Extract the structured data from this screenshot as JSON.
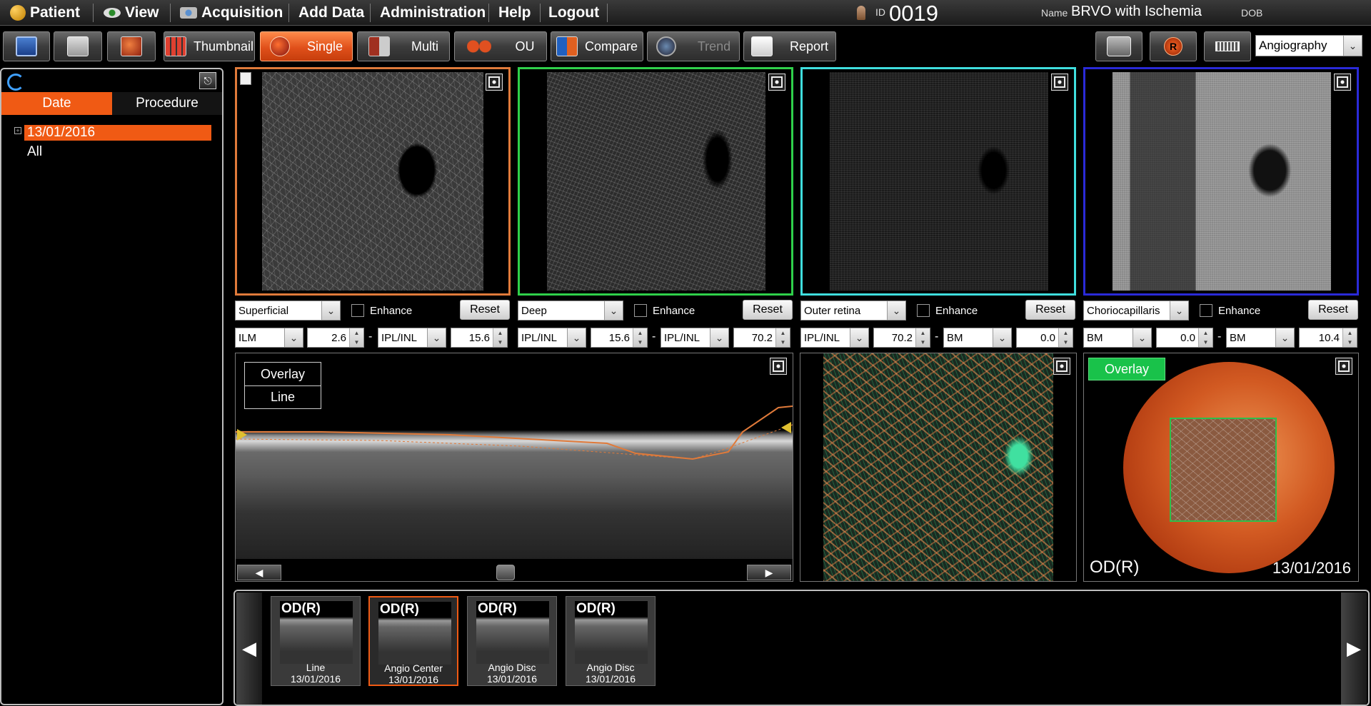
{
  "menu": {
    "items": [
      {
        "label": "Patient",
        "icon": "patient-icon"
      },
      {
        "label": "View",
        "icon": "eye-icon"
      },
      {
        "label": "Acquisition",
        "icon": "camera-icon"
      },
      {
        "label": "Add Data"
      },
      {
        "label": "Administration"
      },
      {
        "label": "Help"
      },
      {
        "label": "Logout"
      }
    ],
    "patient_id_label": "ID",
    "patient_id": "0019",
    "name_label": "Name",
    "name": "BRVO with Ischemia",
    "dob_label": "DOB"
  },
  "toolbar": {
    "buttons": [
      {
        "label": "Thumbnail"
      },
      {
        "label": "Single",
        "active": true
      },
      {
        "label": "Multi"
      },
      {
        "label": "OU"
      },
      {
        "label": "Compare"
      },
      {
        "label": "Trend",
        "disabled": true
      },
      {
        "label": "Report"
      }
    ],
    "right_icon_badge": "R",
    "mode_select": "Angiography"
  },
  "left": {
    "tabs": [
      "Date",
      "Procedure"
    ],
    "active_tab": "Date",
    "tree": [
      "13/01/2016",
      "All"
    ],
    "tree_expander": "+"
  },
  "layers": [
    {
      "preset": "Superficial",
      "enhance_label": "Enhance",
      "reset": "Reset",
      "top_layer": "ILM",
      "top_offset": "2.6",
      "bottom_layer": "IPL/INL",
      "bottom_offset": "15.6",
      "border": "#e07a3a"
    },
    {
      "preset": "Deep",
      "enhance_label": "Enhance",
      "reset": "Reset",
      "top_layer": "IPL/INL",
      "top_offset": "15.6",
      "bottom_layer": "IPL/INL",
      "bottom_offset": "70.2",
      "border": "#2fd04a"
    },
    {
      "preset": "Outer retina",
      "enhance_label": "Enhance",
      "reset": "Reset",
      "top_layer": "IPL/INL",
      "top_offset": "70.2",
      "bottom_layer": "BM",
      "bottom_offset": "0.0",
      "border": "#3fdede"
    },
    {
      "preset": "Choriocapillaris",
      "enhance_label": "Enhance",
      "reset": "Reset",
      "top_layer": "BM",
      "top_offset": "0.0",
      "bottom_layer": "BM",
      "bottom_offset": "10.4",
      "border": "#2a2ad8"
    }
  ],
  "bscan": {
    "modes": [
      "Overlay",
      "Line"
    ],
    "scroll_left": "◀",
    "scroll_right": "▶"
  },
  "fundus": {
    "overlay_label": "Overlay",
    "eye": "OD(R)",
    "date": "13/01/2016"
  },
  "thumbnails": {
    "nav_left": "◀",
    "nav_right": "▶",
    "items": [
      {
        "eye": "OD(R)",
        "label": "Line",
        "date": "13/01/2016",
        "selected": false
      },
      {
        "eye": "OD(R)",
        "label": "Angio Center",
        "date": "13/01/2016",
        "selected": true
      },
      {
        "eye": "OD(R)",
        "label": "Angio Disc",
        "date": "13/01/2016",
        "selected": false
      },
      {
        "eye": "OD(R)",
        "label": "Angio Disc",
        "date": "13/01/2016",
        "selected": false
      }
    ]
  },
  "colors": {
    "accent": "#f05a14",
    "overlay_green": "#19c24a",
    "segmentation_line": "#e07a3a"
  }
}
